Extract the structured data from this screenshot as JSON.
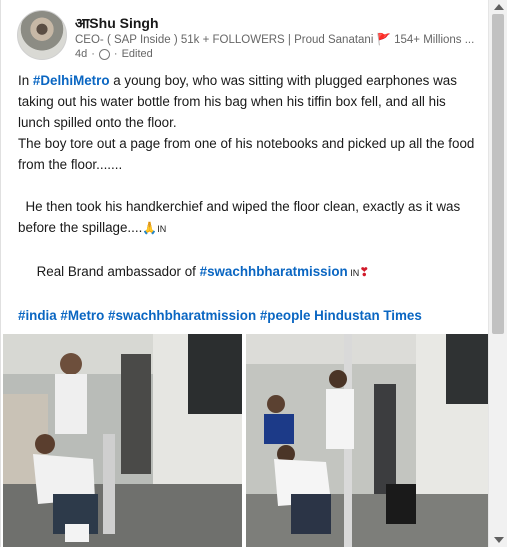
{
  "author": {
    "name": "आShu Singh",
    "headline": "CEO- ( SAP Inside ) 51k + FOLLOWERS | Proud Sanatani 🚩 154+ Millions ...",
    "time": "4d",
    "separator": "·",
    "edited": "Edited"
  },
  "post": {
    "line1_prefix": "In ",
    "line1_hashtag": "#DelhiMetro",
    "line1_rest": " a young boy, who was sitting with plugged earphones was taking out his water bottle from his bag when his tiffin box fell, and all his lunch spilled onto the floor.",
    "line2": "The boy tore out a page from one of his notebooks and picked up all the food from the floor.......",
    "line3": "  He then took his handkerchief and wiped the floor clean, exactly as it was before the spillage....",
    "line3_emoji": "🙏",
    "line3_suffix": "IN",
    "line4_prefix": "     Real Brand ambassador of ",
    "line4_hashtag": "#swachhbharatmission",
    "line4_suffix": " IN",
    "line4_emoji": "❣",
    "hashtags": "#india #Metro #swachhbharatmission #people Hindustan Times"
  },
  "colors": {
    "link": "#0a66c2",
    "text": "#191919",
    "muted": "#666666"
  },
  "icons": {
    "visibility": "globe-icon"
  }
}
